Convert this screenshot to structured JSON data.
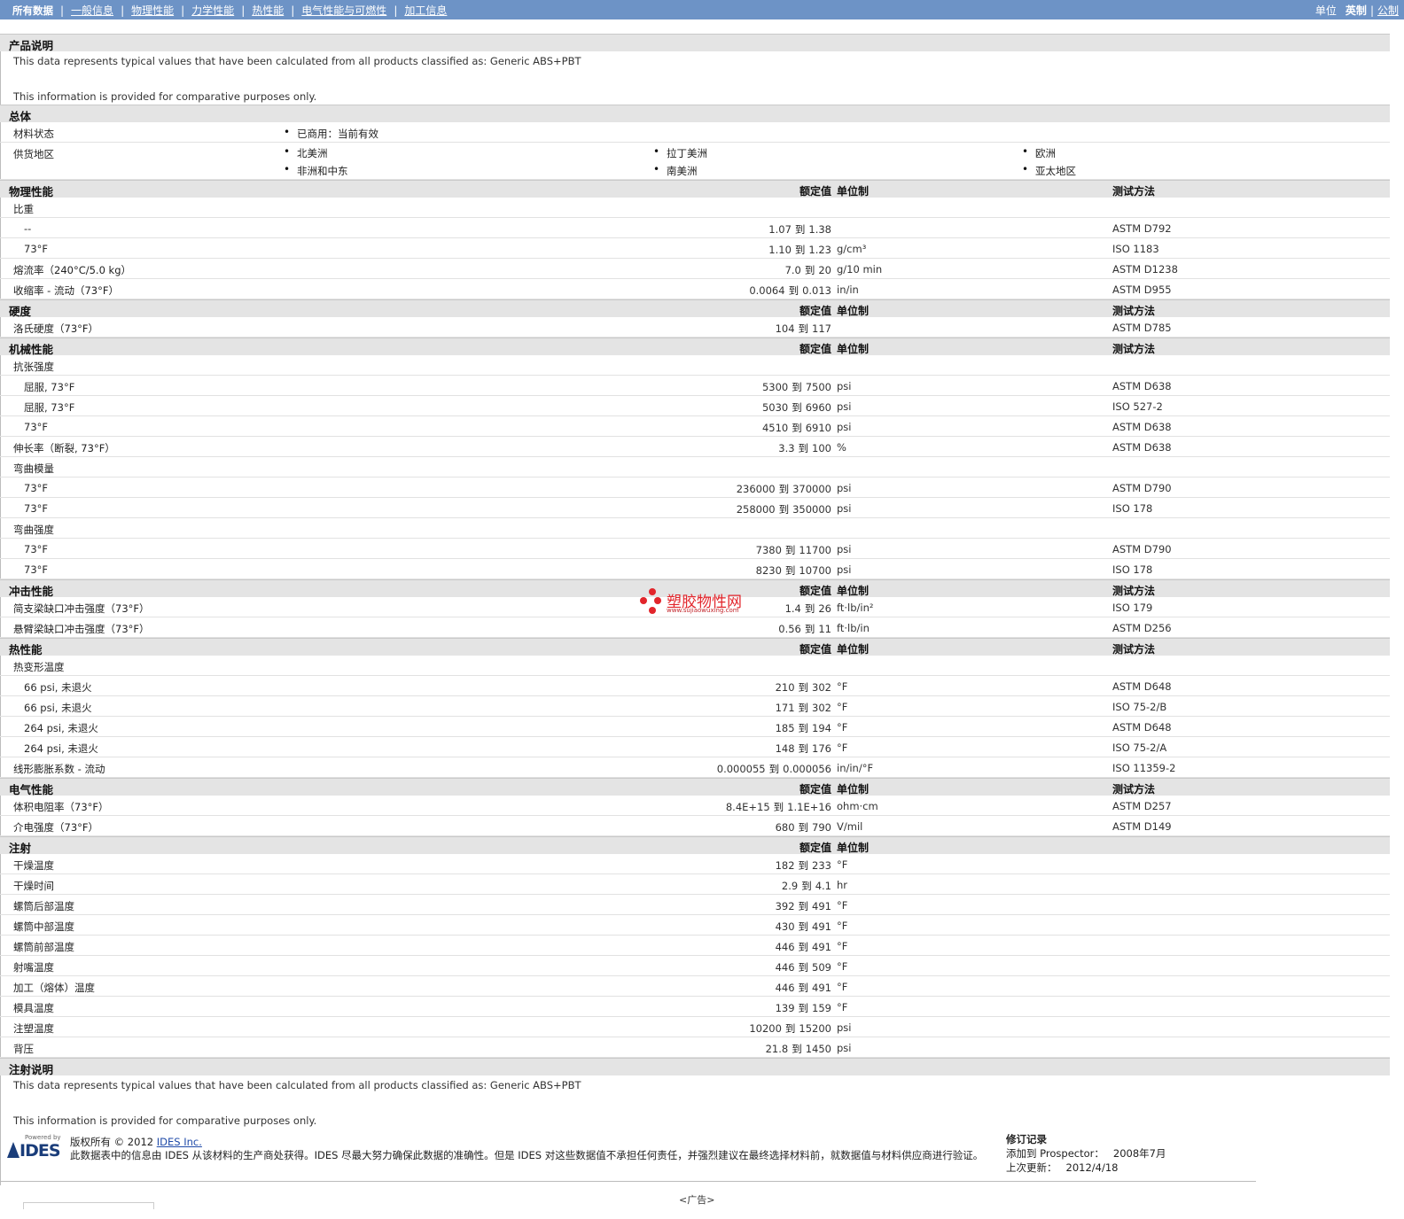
{
  "nav": {
    "all_label": "所有数据",
    "links": [
      "一般信息",
      "物理性能",
      "力学性能",
      "热性能",
      "电气性能与可燃性",
      "加工信息"
    ],
    "unit_label": "单位",
    "unit_current": "英制",
    "unit_alt": "公制"
  },
  "desc": {
    "title": "产品说明",
    "line1": "This data represents typical values that have been calculated from all products classified as: Generic ABS+PBT",
    "line2": "This information is provided for comparative purposes only."
  },
  "general": {
    "title": "总体",
    "status_label": "材料状态",
    "status_value": "已商用：当前有效",
    "region_label": "供货地区",
    "regions": [
      "北美洲",
      "拉丁美洲",
      "欧洲",
      "非洲和中东",
      "南美洲",
      "亚太地区"
    ]
  },
  "headers": {
    "nominal": "额定值",
    "unit": "单位制",
    "test": "测试方法"
  },
  "range_sep": "到",
  "physical": {
    "title": "物理性能",
    "sg_label": "比重",
    "rows": [
      {
        "label": "--",
        "lo": "1.07",
        "hi": "1.38",
        "unit": "",
        "test": "ASTM D792"
      },
      {
        "label": "73°F",
        "lo": "1.10",
        "hi": "1.23",
        "unit": "g/cm³",
        "test": "ISO 1183"
      },
      {
        "label": "熔流率（240°C/5.0 kg）",
        "lo": "7.0",
        "hi": "20",
        "unit": "g/10 min",
        "test": "ASTM D1238"
      },
      {
        "label": "收缩率 - 流动（73°F）",
        "lo": "0.0064",
        "hi": "0.013",
        "unit": "in/in",
        "test": "ASTM D955"
      }
    ]
  },
  "hardness": {
    "title": "硬度",
    "rows": [
      {
        "label": "洛氏硬度（73°F）",
        "lo": "104",
        "hi": "117",
        "unit": "",
        "test": "ASTM D785"
      }
    ]
  },
  "mechanical": {
    "title": "机械性能",
    "tensile_label": "抗张强度",
    "tensile": [
      {
        "label": "屈服, 73°F",
        "lo": "5300",
        "hi": "7500",
        "unit": "psi",
        "test": "ASTM D638"
      },
      {
        "label": "屈服, 73°F",
        "lo": "5030",
        "hi": "6960",
        "unit": "psi",
        "test": "ISO 527-2"
      },
      {
        "label": "73°F",
        "lo": "4510",
        "hi": "6910",
        "unit": "psi",
        "test": "ASTM D638"
      }
    ],
    "elong": {
      "label": "伸长率（断裂, 73°F）",
      "lo": "3.3",
      "hi": "100",
      "unit": "%",
      "test": "ASTM D638"
    },
    "fmod_label": "弯曲模量",
    "fmod": [
      {
        "label": "73°F",
        "lo": "236000",
        "hi": "370000",
        "unit": "psi",
        "test": "ASTM D790"
      },
      {
        "label": "73°F",
        "lo": "258000",
        "hi": "350000",
        "unit": "psi",
        "test": "ISO 178"
      }
    ],
    "fstr_label": "弯曲强度",
    "fstr": [
      {
        "label": "73°F",
        "lo": "7380",
        "hi": "11700",
        "unit": "psi",
        "test": "ASTM D790"
      },
      {
        "label": "73°F",
        "lo": "8230",
        "hi": "10700",
        "unit": "psi",
        "test": "ISO 178"
      }
    ]
  },
  "impact": {
    "title": "冲击性能",
    "rows": [
      {
        "label": "简支梁缺口冲击强度（73°F）",
        "lo": "1.4",
        "hi": "26",
        "unit": "ft·lb/in²",
        "test": "ISO 179"
      },
      {
        "label": "悬臂梁缺口冲击强度（73°F）",
        "lo": "0.56",
        "hi": "11",
        "unit": "ft·lb/in",
        "test": "ASTM D256"
      }
    ]
  },
  "thermal": {
    "title": "热性能",
    "hdt_label": "热变形温度",
    "hdt": [
      {
        "label": "66 psi, 未退火",
        "lo": "210",
        "hi": "302",
        "unit": "°F",
        "test": "ASTM D648"
      },
      {
        "label": "66 psi, 未退火",
        "lo": "171",
        "hi": "302",
        "unit": "°F",
        "test": "ISO 75-2/B"
      },
      {
        "label": "264 psi, 未退火",
        "lo": "185",
        "hi": "194",
        "unit": "°F",
        "test": "ASTM D648"
      },
      {
        "label": "264 psi, 未退火",
        "lo": "148",
        "hi": "176",
        "unit": "°F",
        "test": "ISO 75-2/A"
      }
    ],
    "clte": {
      "label": "线形膨胀系数 - 流动",
      "lo": "0.000055",
      "hi": "0.000056",
      "unit": "in/in/°F",
      "test": "ISO 11359-2"
    }
  },
  "electrical": {
    "title": "电气性能",
    "rows": [
      {
        "label": "体积电阻率（73°F）",
        "lo": "8.4E+15",
        "hi": "1.1E+16",
        "unit": "ohm·cm",
        "test": "ASTM D257"
      },
      {
        "label": "介电强度（73°F）",
        "lo": "680",
        "hi": "790",
        "unit": "V/mil",
        "test": "ASTM D149"
      }
    ]
  },
  "injection": {
    "title": "注射",
    "rows": [
      {
        "label": "干燥温度",
        "lo": "182",
        "hi": "233",
        "unit": "°F"
      },
      {
        "label": "干燥时间",
        "lo": "2.9",
        "hi": "4.1",
        "unit": "hr"
      },
      {
        "label": "螺筒后部温度",
        "lo": "392",
        "hi": "491",
        "unit": "°F"
      },
      {
        "label": "螺筒中部温度",
        "lo": "430",
        "hi": "491",
        "unit": "°F"
      },
      {
        "label": "螺筒前部温度",
        "lo": "446",
        "hi": "491",
        "unit": "°F"
      },
      {
        "label": "射嘴温度",
        "lo": "446",
        "hi": "509",
        "unit": "°F"
      },
      {
        "label": "加工（熔体）温度",
        "lo": "446",
        "hi": "491",
        "unit": "°F"
      },
      {
        "label": "模具温度",
        "lo": "139",
        "hi": "159",
        "unit": "°F"
      },
      {
        "label": "注塑温度",
        "lo": "10200",
        "hi": "15200",
        "unit": "psi"
      },
      {
        "label": "背压",
        "lo": "21.8",
        "hi": "1450",
        "unit": "psi"
      }
    ]
  },
  "inj_notes": {
    "title": "注射说明",
    "line1": "This data represents typical values that have been calculated from all products classified as: Generic ABS+PBT",
    "line2": "This information is provided for comparative purposes only."
  },
  "watermark": {
    "name": "塑胶物性网",
    "url": "www.sujiaowuxing.com"
  },
  "footer": {
    "powered_by": "Powered by",
    "logo_text": "IDES",
    "copyright": "版权所有 © 2012 ",
    "company": "IDES Inc.",
    "disclaimer": "此数据表中的信息由 IDES 从该材料的生产商处获得。IDES 尽最大努力确保此数据的准确性。但是 IDES 对这些数据值不承担任何责任，并强烈建议在最终选择材料前，就数据值与材料供应商进行验证。",
    "rev_title": "修订记录",
    "added_label": "添加到 Prospector：",
    "added_value": "2008年7月",
    "updated_label": "上次更新：",
    "updated_value": "2012/4/18",
    "ad": "<广告>"
  }
}
